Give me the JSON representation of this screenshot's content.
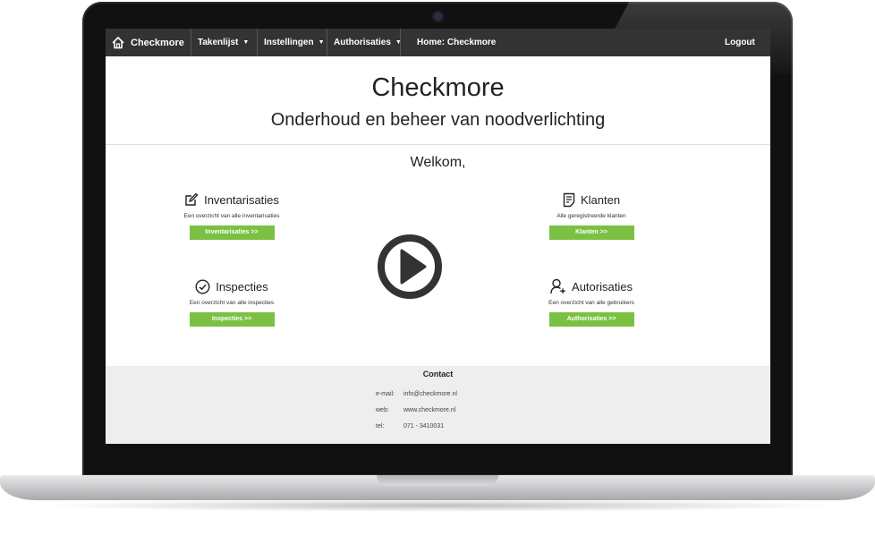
{
  "navbar": {
    "brand": "Checkmore",
    "menus": [
      {
        "label": "Takenlijst"
      },
      {
        "label": "Instellingen"
      },
      {
        "label": "Authorisaties"
      }
    ],
    "home": "Home: Checkmore",
    "logout": "Logout"
  },
  "header": {
    "title": "Checkmore",
    "subtitle": "Onderhoud en beheer van noodverlichting",
    "welcome": "Welkom,"
  },
  "features": {
    "inventarisaties": {
      "title": "Inventarisaties",
      "desc": "Een overzicht van alle inventarisaties",
      "button": "Inventarisaties >>",
      "icon": "edit-icon"
    },
    "klanten": {
      "title": "Klanten",
      "desc": "Alle geregistreerde klanten",
      "button": "Klanten >>",
      "icon": "document-icon"
    },
    "inspecties": {
      "title": "Inspecties",
      "desc": "Een overzicht van alle inspecties",
      "button": "Inspecties >>",
      "icon": "check-circle-icon"
    },
    "autorisaties": {
      "title": "Autorisaties",
      "desc": "Een overzicht van alle gebruikers",
      "button": "Authorisaties >>",
      "icon": "add-user-icon"
    }
  },
  "footer": {
    "title": "Contact",
    "rows": [
      {
        "label": "e-mail:",
        "value": "info@checkmore.nl"
      },
      {
        "label": "web:",
        "value": "www.checkmore.nl"
      },
      {
        "label": "tel:",
        "value": "071 - 3410031"
      }
    ]
  },
  "colors": {
    "navbar": "#333333",
    "button_green": "#7ac143",
    "footer_bg": "#eeeeef"
  }
}
